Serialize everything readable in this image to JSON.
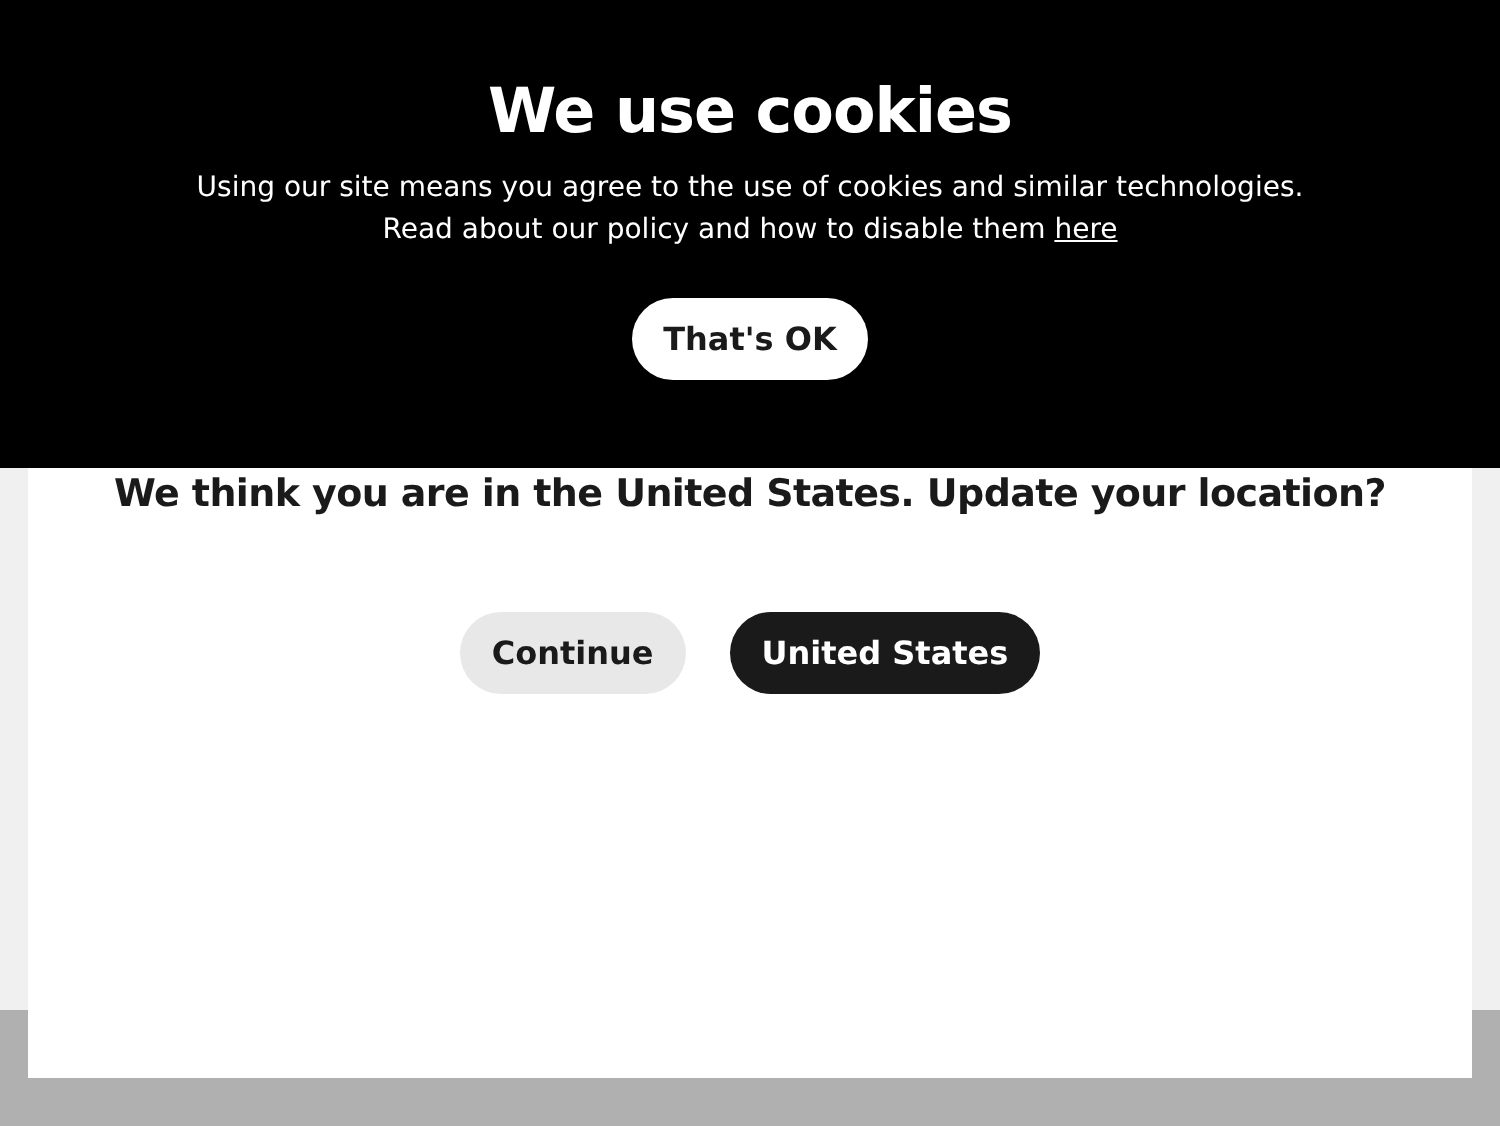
{
  "cookie_banner": {
    "title": "We use cookies",
    "lines": [
      "Using our site means you agree to the use of cookies and similar technologies.",
      "Read about our policy and how to disable them"
    ],
    "link": "here",
    "button": "That's OK"
  },
  "location_dialog": {
    "question": "We think you are in the United States. Update your location?",
    "buttons": [
      {
        "kind": "secondary",
        "label": "Continue"
      },
      {
        "kind": "primary",
        "label": "United States"
      }
    ]
  }
}
